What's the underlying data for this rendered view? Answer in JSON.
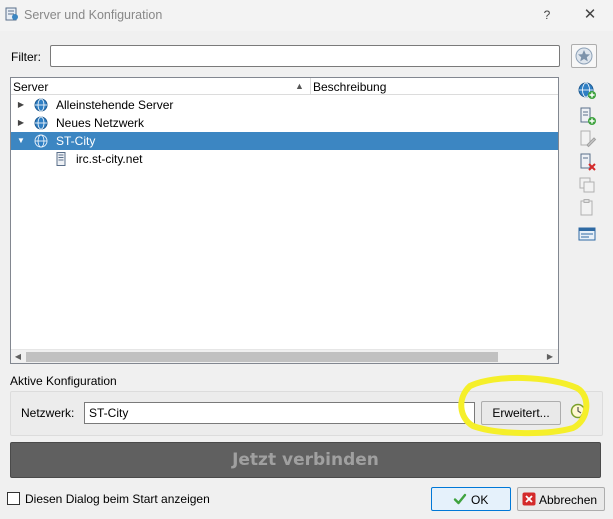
{
  "window": {
    "title": "Server und Konfiguration",
    "help_label": "?",
    "close_glyph": "✕"
  },
  "filter": {
    "label": "Filter:",
    "value": "",
    "favorite_icon": "star-icon"
  },
  "tree": {
    "columns": [
      "Server",
      "Beschreibung"
    ],
    "sort_indicator": "▲",
    "rows": [
      {
        "label": "Alleinstehende Server",
        "icon": "globe-icon",
        "expanded": false,
        "selected": false
      },
      {
        "label": "Neues Netzwerk",
        "icon": "globe-icon",
        "expanded": false,
        "selected": false
      },
      {
        "label": "ST-City",
        "icon": "globe-icon",
        "expanded": true,
        "selected": true
      },
      {
        "label": "irc.st-city.net",
        "icon": "server-icon",
        "child": true
      }
    ]
  },
  "toolbar": {
    "icons": [
      "add-network-icon",
      "add-server-icon",
      "edit-icon",
      "delete-icon",
      "copy-icon",
      "paste-icon",
      "settings-icon"
    ]
  },
  "config": {
    "section_label": "Aktive Konfiguration",
    "network_label": "Netzwerk:",
    "network_value": "ST-City",
    "advanced_label": "Erweitert..."
  },
  "connect": {
    "label": "Jetzt verbinden"
  },
  "footer": {
    "startup_label": "Diesen Dialog beim Start anzeigen",
    "startup_checked": false,
    "ok_label": "OK",
    "cancel_label": "Abbrechen"
  },
  "colors": {
    "selection": "#3c86c2",
    "connect_bg": "#606060",
    "annotation": "#f5ef2a"
  }
}
